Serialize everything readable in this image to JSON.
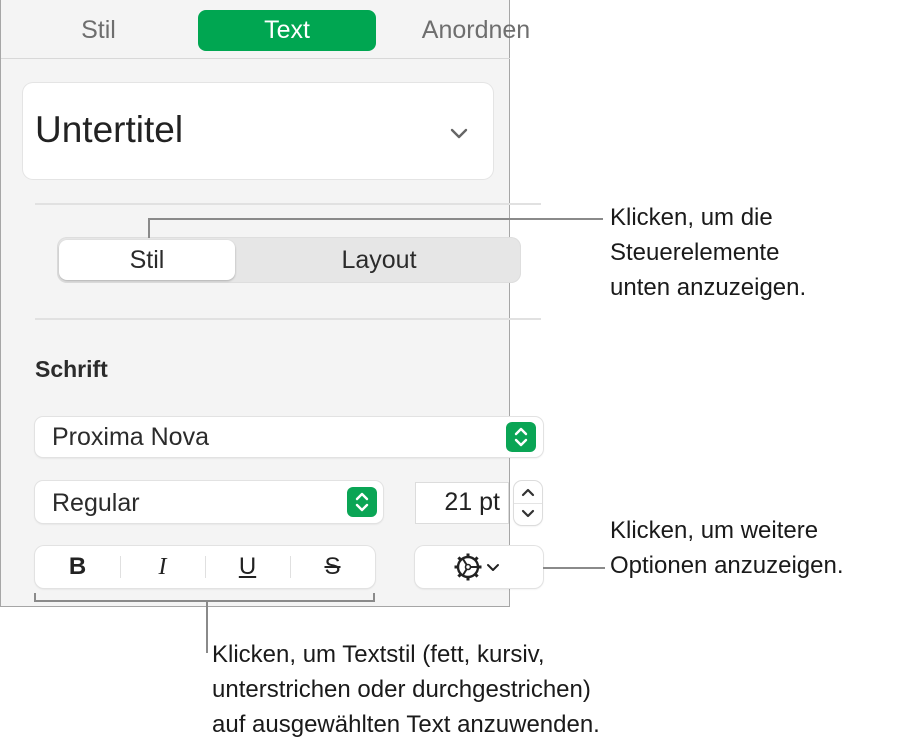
{
  "tabs": [
    {
      "label": "Stil",
      "active": false
    },
    {
      "label": "Text",
      "active": true
    },
    {
      "label": "Anordnen",
      "active": false
    }
  ],
  "paragraph_style": {
    "value": "Untertitel",
    "icon": "chevron-down-icon"
  },
  "segmented": {
    "options": [
      {
        "label": "Stil",
        "selected": true
      },
      {
        "label": "Layout",
        "selected": false
      }
    ]
  },
  "font_section": {
    "heading": "Schrift",
    "font_family": "Proxima Nova",
    "font_typeface": "Regular",
    "font_size": "21 pt",
    "format_buttons": [
      {
        "label": "B",
        "name": "bold"
      },
      {
        "label": "I",
        "name": "italic"
      },
      {
        "label": "U",
        "name": "underline"
      },
      {
        "label": "S",
        "name": "strikethrough"
      }
    ],
    "more_options_icon": "gear-icon"
  },
  "callouts": {
    "segmented": "Klicken, um die\nSteuerelemente\nunten anzuzeigen.",
    "more_options": "Klicken, um weitere\nOptionen anzuzeigen.",
    "format": "Klicken, um Textstil (fett, kursiv,\nunterstrichen oder durchgestrichen)\nauf ausgewählten Text anzuwenden."
  },
  "colors": {
    "accent": "#00a651",
    "panel_bg": "#f4f4f4",
    "callout_line": "#8a8a8a"
  }
}
